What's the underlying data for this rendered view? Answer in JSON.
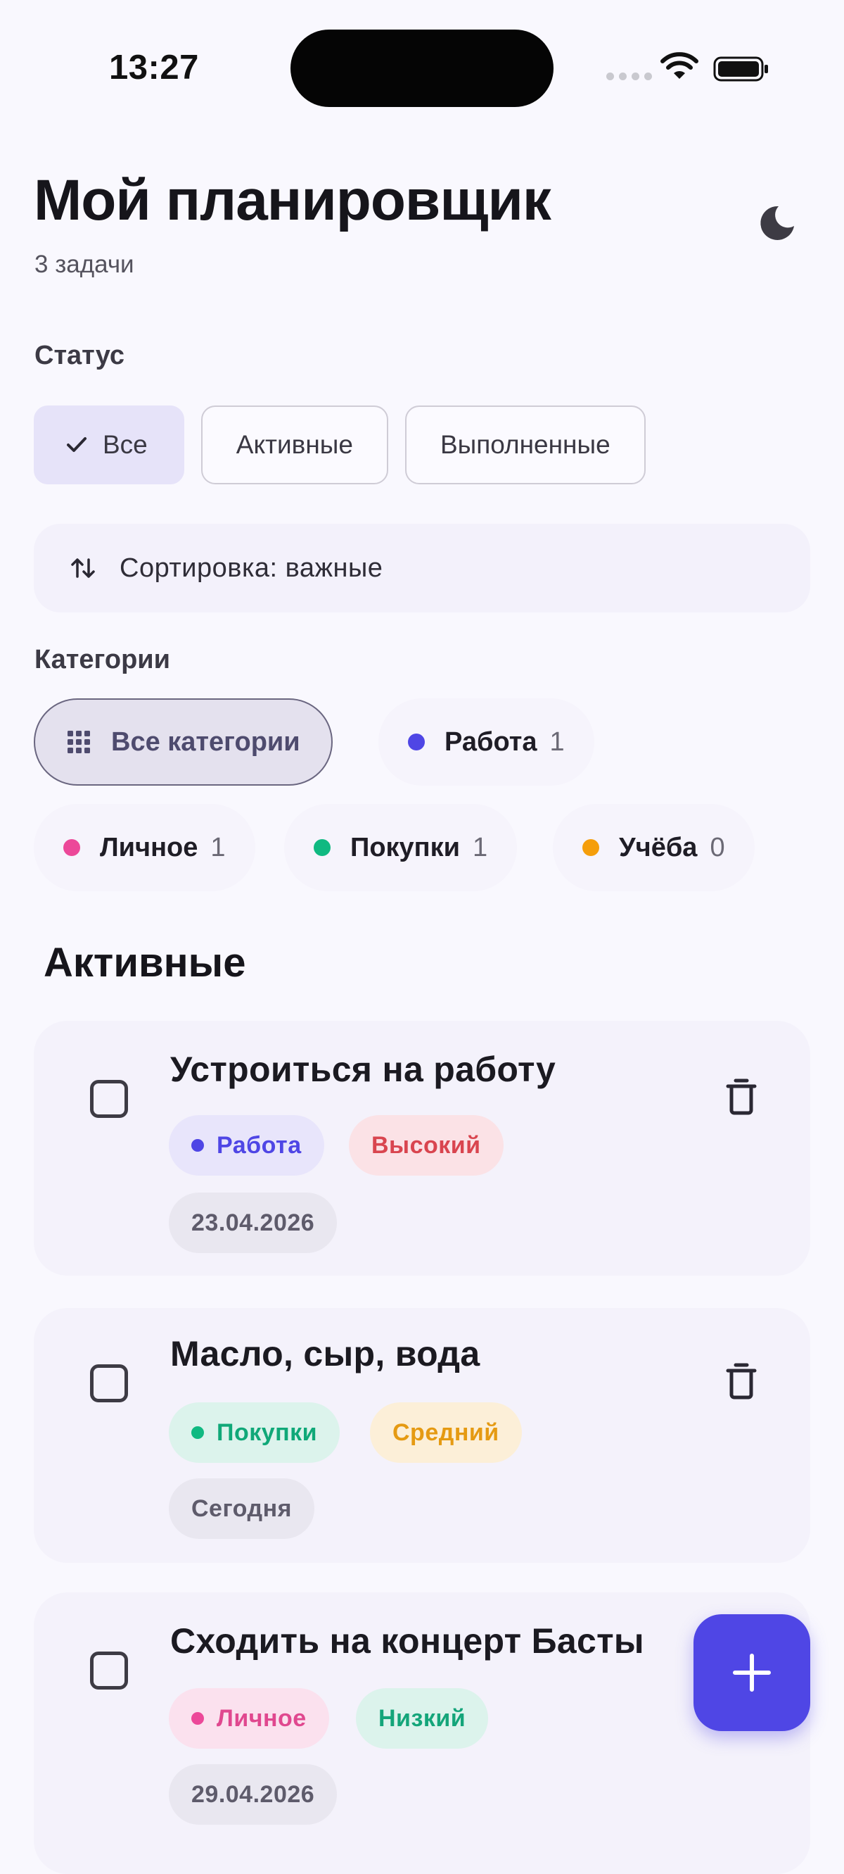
{
  "status_bar": {
    "time": "13:27"
  },
  "header": {
    "title": "Мой планировщик",
    "task_count": "3 задачи",
    "theme_icon": "moon-icon"
  },
  "status_filter": {
    "label": "Статус",
    "options": [
      "Все",
      "Активные",
      "Выполненные"
    ],
    "selected": "Все"
  },
  "sort": {
    "label": "Сортировка: важные",
    "icon": "sort-arrows-icon"
  },
  "categories": {
    "label": "Категории",
    "all_label": "Все категории",
    "items": [
      {
        "name": "Работа",
        "count": "1",
        "color": "#4f46e5"
      },
      {
        "name": "Личное",
        "count": "1",
        "color": "#ec4899"
      },
      {
        "name": "Покупки",
        "count": "1",
        "color": "#10b981"
      },
      {
        "name": "Учёба",
        "count": "0",
        "color": "#f59e0b"
      }
    ]
  },
  "active_section": {
    "heading": "Активные",
    "tasks": [
      {
        "title": "Устроиться на работу",
        "category": "Работа",
        "category_color": "#4f46e5",
        "category_bg": "#e8e5fb",
        "priority": "Высокий",
        "priority_color": "#d9454f",
        "priority_bg": "#fbe2e6",
        "date": "23.04.2026",
        "completed": false
      },
      {
        "title": "Масло, сыр, вода",
        "category": "Покупки",
        "category_color": "#10b981",
        "category_bg": "#dcf3ec",
        "priority": "Средний",
        "priority_color": "#e59a12",
        "priority_bg": "#fcefd8",
        "date": "Сегодня",
        "completed": false
      },
      {
        "title": "Сходить на концерт Басты",
        "category": "Личное",
        "category_color": "#ec4899",
        "category_bg": "#fbe1ee",
        "priority": "Низкий",
        "priority_color": "#14a57a",
        "priority_bg": "#dcf3ec",
        "date": "29.04.2026",
        "completed": false
      }
    ]
  },
  "fab": {
    "icon": "plus-icon"
  },
  "colors": {
    "accent": "#4f46e5",
    "background": "#f9f8fe"
  }
}
